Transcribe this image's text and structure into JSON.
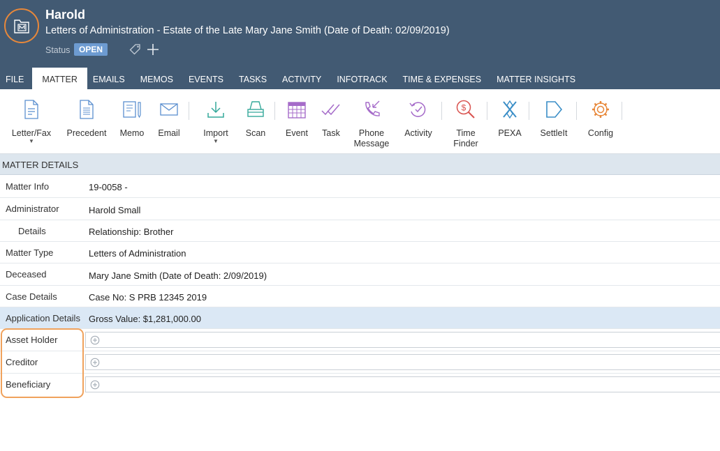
{
  "header": {
    "title": "Harold",
    "description": "Letters of Administration - Estate of the Late Mary Jane Smith (Date of Death: 02/09/2019)",
    "status_label": "Status",
    "status_value": "OPEN"
  },
  "tabs": [
    "FILE",
    "MATTER",
    "EMAILS",
    "MEMOS",
    "EVENTS",
    "TASKS",
    "ACTIVITY",
    "INFOTRACK",
    "TIME & EXPENSES",
    "MATTER INSIGHTS"
  ],
  "active_tab": "MATTER",
  "ribbon": [
    {
      "label": "Letter/Fax",
      "icon": "letter-icon",
      "dropdown": true
    },
    {
      "label": "Precedent",
      "icon": "precedent-icon"
    },
    {
      "label": "Memo",
      "icon": "memo-icon"
    },
    {
      "label": "Email",
      "icon": "email-icon"
    },
    {
      "label": "Import",
      "icon": "import-icon",
      "dropdown": true
    },
    {
      "label": "Scan",
      "icon": "scan-icon"
    },
    {
      "label": "Event",
      "icon": "calendar-icon"
    },
    {
      "label": "Task",
      "icon": "task-icon"
    },
    {
      "label": "Phone Message",
      "label_line1": "Phone",
      "label_line2": "Message",
      "icon": "phone-icon"
    },
    {
      "label": "Activity",
      "icon": "activity-icon"
    },
    {
      "label": "Time Finder",
      "label_line1": "Time",
      "label_line2": "Finder",
      "icon": "time-finder-icon"
    },
    {
      "label": "PEXA",
      "icon": "pexa-icon"
    },
    {
      "label": "SettleIt",
      "icon": "settleit-icon"
    },
    {
      "label": "Config",
      "icon": "gear-icon"
    }
  ],
  "matter_details": {
    "heading": "MATTER DETAILS",
    "rows": [
      {
        "label": "Matter Info",
        "value": "19-0058 -"
      },
      {
        "label": "Administrator",
        "value": "Harold Small"
      },
      {
        "label": "Details",
        "value": "Relationship: Brother"
      },
      {
        "label": "Matter Type",
        "value": "Letters of Administration"
      },
      {
        "label": "Deceased",
        "value": "Mary Jane Smith (Date of Death: 2/09/2019)"
      },
      {
        "label": "Case Details",
        "value": "Case No: S PRB 12345 2019"
      },
      {
        "label": "Application Details",
        "value": "Gross Value: $1,281,000.00"
      },
      {
        "label": "Asset Holder",
        "value": ""
      },
      {
        "label": "Creditor",
        "value": ""
      },
      {
        "label": "Beneficiary",
        "value": ""
      }
    ]
  },
  "colors": {
    "header_bg": "#425a73",
    "accent_orange": "#e8883a",
    "status_badge": "#6d9bd1",
    "section_bg": "#dde6ee",
    "highlight_row": "#dbe8f5",
    "icon_blue": "#5b8fcf",
    "icon_teal": "#34a89a",
    "icon_purple": "#a56bc9",
    "icon_red": "#d9534f",
    "icon_orange": "#e8883a"
  }
}
